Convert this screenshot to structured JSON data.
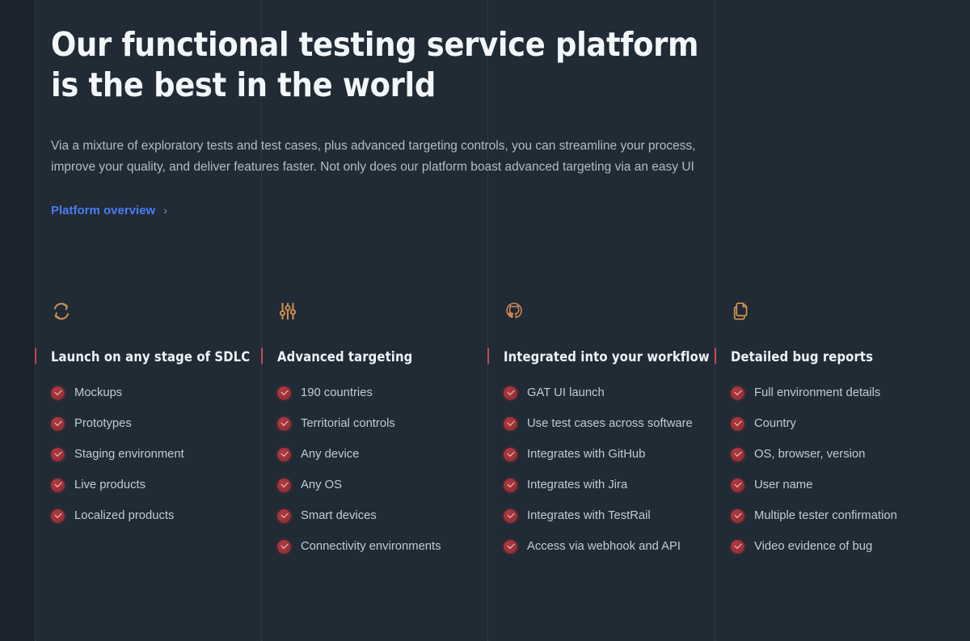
{
  "hero": {
    "headline": "Our functional testing service platform is the best in the world",
    "lede": "Via a mixture of exploratory tests and test cases, plus advanced targeting controls, you can streamline your process, improve your quality, and deliver features faster. Not only does our platform boast advanced targeting via an easy UI",
    "link_label": "Platform overview",
    "link_chevron": "›"
  },
  "theme": {
    "background": "#202b36",
    "gutter": "#1b242e",
    "guide_line": "#3a4753",
    "accent_link": "#4d7cf3",
    "accent_bar": "#c64a52",
    "check_badge": "#993036",
    "heading_text": "#f4f7fa",
    "body_text": "#b2bcc6"
  },
  "columns": [
    {
      "icon": "refresh-cycle-icon",
      "title": "Launch on any stage of SDLC",
      "items": [
        "Mockups",
        "Prototypes",
        "Staging environment",
        "Live products",
        "Localized products"
      ]
    },
    {
      "icon": "sliders-icon",
      "title": "Advanced targeting",
      "items": [
        "190 countries",
        "Territorial controls",
        "Any device",
        "Any OS",
        "Smart devices",
        "Connectivity environments"
      ]
    },
    {
      "icon": "github-icon",
      "title": "Integrated into your workflow",
      "items": [
        "GAT UI launch",
        "Use test cases across software",
        "Integrates with GitHub",
        "Integrates with Jira",
        "Integrates with TestRail",
        "Access via webhook and API"
      ]
    },
    {
      "icon": "copy-documents-icon",
      "title": "Detailed bug reports",
      "items": [
        "Full environment details",
        "Country",
        "OS, browser, version",
        "User name",
        "Multiple tester confirmation",
        "Video evidence of bug"
      ]
    }
  ]
}
